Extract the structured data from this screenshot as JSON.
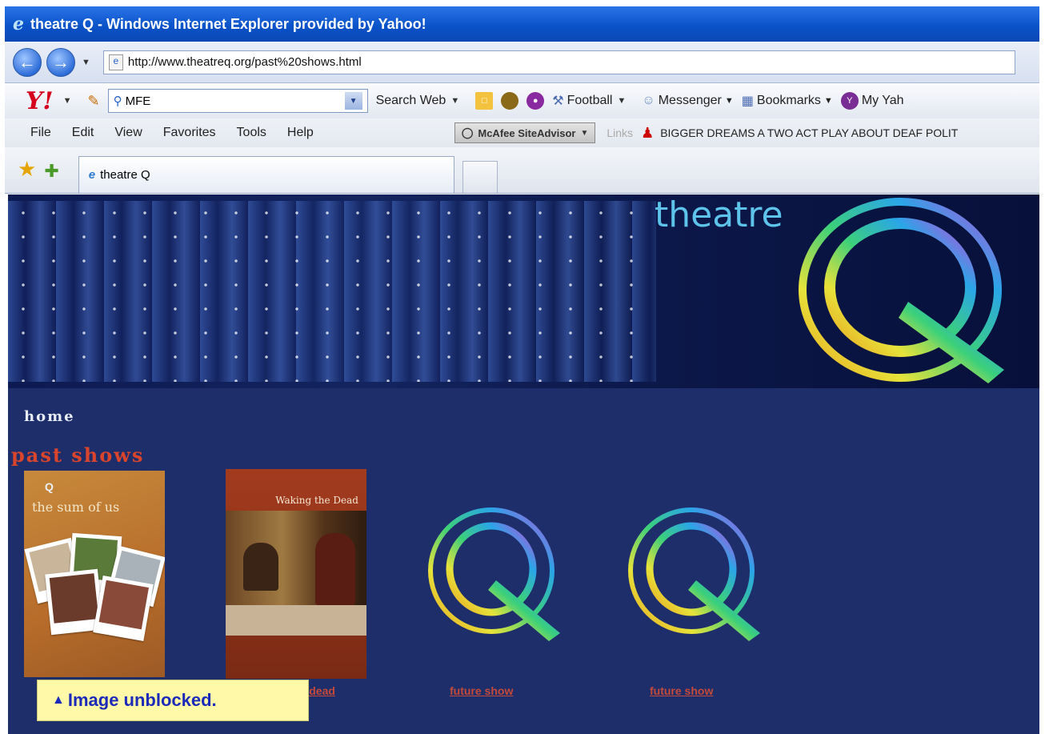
{
  "window": {
    "title": "theatre Q - Windows Internet Explorer provided by Yahoo!"
  },
  "address_bar": {
    "url": "http://www.theatreq.org/past%20shows.html"
  },
  "yahoo_toolbar": {
    "search_value": "MFE",
    "search_web_label": "Search Web",
    "football_label": "Football",
    "messenger_label": "Messenger",
    "bookmarks_label": "Bookmarks",
    "my_yahoo_label": "My Yah"
  },
  "menu": {
    "items": [
      "File",
      "Edit",
      "View",
      "Favorites",
      "Tools",
      "Help"
    ],
    "mcafee_label": "McAfee SiteAdvisor",
    "links_label": "Links",
    "link_item": "BIGGER DREAMS A TWO ACT PLAY ABOUT DEAF POLIT"
  },
  "tabs": [
    {
      "label": "theatre Q"
    }
  ],
  "page": {
    "banner_word": "theatre",
    "home_link": "home",
    "section_title": "past shows",
    "poster1": {
      "logo": "Q",
      "title": "the sum of us"
    },
    "poster2": {
      "title": "Waking the Dead"
    },
    "captions": [
      "waking the dead",
      "future show",
      "future show"
    ]
  },
  "notification": {
    "text": "Image unblocked."
  },
  "colors": {
    "page_bg": "#1e2e6a",
    "section_title": "#d8442c",
    "titlebar": "#0b53c9"
  }
}
